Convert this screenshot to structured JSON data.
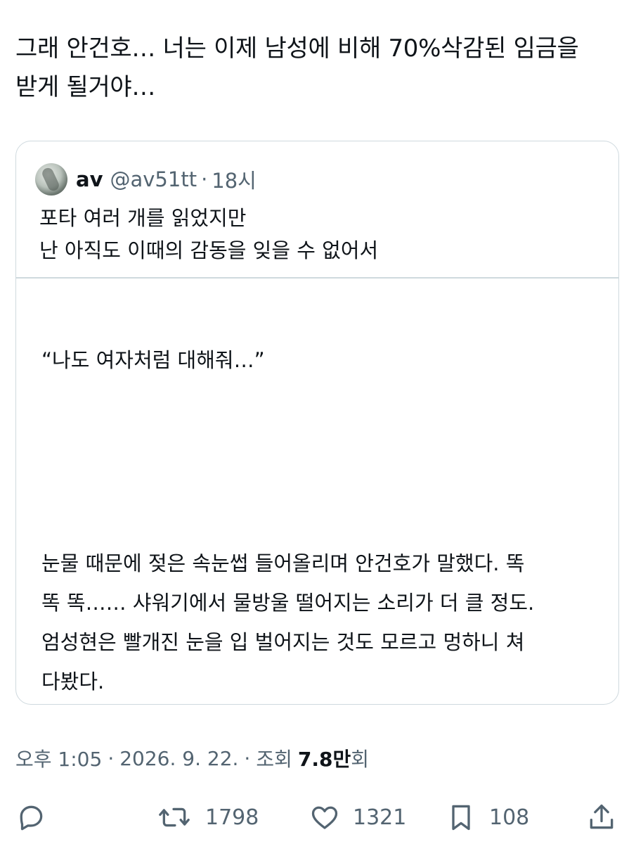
{
  "tweet": {
    "text_lines": [
      "그래 안건호… 너는 이제 남성에 비해 70%삭감된 임금을",
      "받게 될거야…"
    ]
  },
  "quote": {
    "name": "av",
    "handle": "@av51tt",
    "separator": "·",
    "time": "18시",
    "text_lines": [
      "포타 여러 개를 읽었지만",
      "난 아직도 이때의 감동을 잊을 수 없어서"
    ],
    "excerpt": {
      "quote_line": "“나도 여자처럼 대해줘…”",
      "body_lines": [
        " 눈물 때문에 젖은 속눈썹 들어올리며 안건호가 말했다. 똑",
        "똑 똑…… 샤워기에서 물방울 떨어지는 소리가 더 클 정도.",
        "엄성현은 빨개진 눈을 입 벌어지는 것도 모르고 멍하니 쳐",
        "다봤다."
      ]
    }
  },
  "meta": {
    "time": "오후 1:05",
    "sep1": "·",
    "date": "2026. 9. 22.",
    "sep2": "·",
    "views_label": "조회",
    "views_value": "7.8만",
    "views_suffix": "회"
  },
  "actions": {
    "reply": {
      "icon": "reply-icon",
      "count": ""
    },
    "retweet": {
      "icon": "retweet-icon",
      "count": "1798"
    },
    "like": {
      "icon": "heart-icon",
      "count": "1321"
    },
    "bookmark": {
      "icon": "bookmark-icon",
      "count": "108"
    },
    "share": {
      "icon": "share-icon",
      "count": ""
    }
  },
  "colors": {
    "text": "#0f1419",
    "secondary": "#536471",
    "border": "#cfd9de"
  }
}
